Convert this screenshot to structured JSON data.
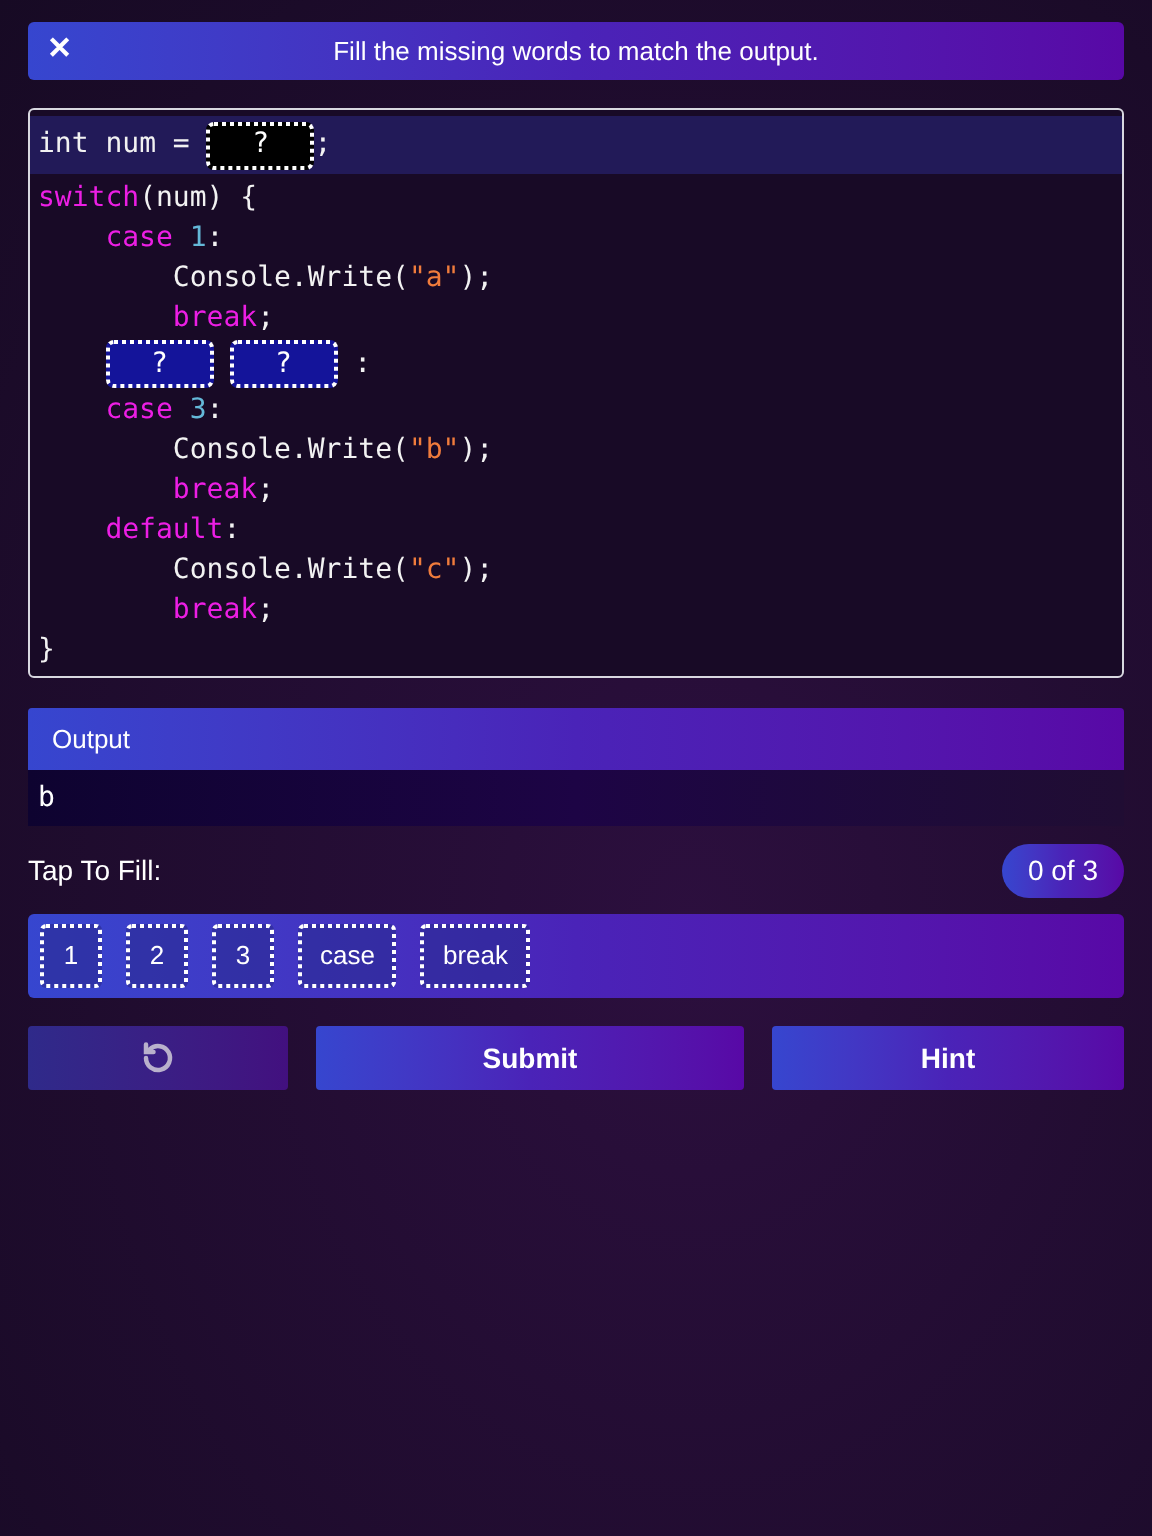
{
  "header": {
    "close": "✕",
    "title": "Fill the missing words to match the output."
  },
  "code": {
    "lines": [
      {
        "active": true,
        "tokens": [
          {
            "kind": "plain",
            "text": "int num = "
          },
          {
            "kind": "blank",
            "text": "?",
            "active": true
          },
          {
            "kind": "plain",
            "text": ";"
          }
        ]
      },
      {
        "active": false,
        "tokens": [
          {
            "kind": "keyword",
            "text": "switch"
          },
          {
            "kind": "plain",
            "text": "(num) {"
          }
        ],
        "children": [
          {
            "active": false,
            "tokens": [
              {
                "kind": "keyword",
                "text": "case "
              },
              {
                "kind": "number",
                "text": "1"
              },
              {
                "kind": "plain",
                "text": ":"
              }
            ],
            "children": [
              {
                "active": false,
                "tokens": [
                  {
                    "kind": "plain",
                    "text": "Console.Write("
                  },
                  {
                    "kind": "string",
                    "text": "\"a\""
                  },
                  {
                    "kind": "plain",
                    "text": ");"
                  }
                ]
              },
              {
                "active": false,
                "tokens": [
                  {
                    "kind": "keyword",
                    "text": "break"
                  },
                  {
                    "kind": "plain",
                    "text": ";"
                  }
                ]
              }
            ]
          },
          {
            "active": false,
            "tokens": [
              {
                "kind": "blank",
                "text": "?",
                "active": false
              },
              {
                "kind": "blank",
                "text": "?",
                "active": false
              },
              {
                "kind": "plain",
                "text": " :"
              }
            ]
          },
          {
            "active": false,
            "tokens": [
              {
                "kind": "keyword",
                "text": "case "
              },
              {
                "kind": "number",
                "text": "3"
              },
              {
                "kind": "plain",
                "text": ":"
              }
            ],
            "children": [
              {
                "active": false,
                "tokens": [
                  {
                    "kind": "plain",
                    "text": "Console.Write("
                  },
                  {
                    "kind": "string",
                    "text": "\"b\""
                  },
                  {
                    "kind": "plain",
                    "text": ");"
                  }
                ]
              },
              {
                "active": false,
                "tokens": [
                  {
                    "kind": "keyword",
                    "text": "break"
                  },
                  {
                    "kind": "plain",
                    "text": ";"
                  }
                ]
              }
            ]
          },
          {
            "active": false,
            "tokens": [
              {
                "kind": "keyword",
                "text": "default"
              },
              {
                "kind": "plain",
                "text": ":"
              }
            ],
            "children": [
              {
                "active": false,
                "tokens": [
                  {
                    "kind": "plain",
                    "text": "Console.Write("
                  },
                  {
                    "kind": "string",
                    "text": "\"c\""
                  },
                  {
                    "kind": "plain",
                    "text": ");"
                  }
                ]
              },
              {
                "active": false,
                "tokens": [
                  {
                    "kind": "keyword",
                    "text": "break"
                  },
                  {
                    "kind": "plain",
                    "text": ";"
                  }
                ]
              }
            ]
          }
        ]
      },
      {
        "active": false,
        "tokens": [
          {
            "kind": "plain",
            "text": "}"
          }
        ]
      }
    ]
  },
  "output": {
    "title": "Output",
    "value": "b"
  },
  "tap": {
    "label": "Tap To Fill:",
    "count": "0 of 3"
  },
  "chips": [
    "1",
    "2",
    "3",
    "case",
    "break"
  ],
  "buttons": {
    "submit": "Submit",
    "hint": "Hint"
  }
}
